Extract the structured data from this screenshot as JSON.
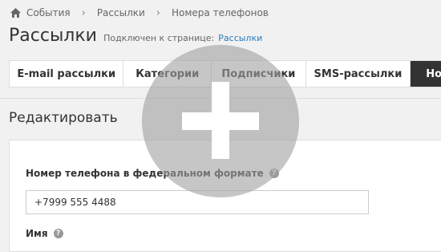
{
  "breadcrumb": {
    "items": [
      {
        "label": "События"
      },
      {
        "label": "Рассылки"
      },
      {
        "label": "Номера телефонов"
      }
    ],
    "separator": "›"
  },
  "header": {
    "title": "Рассылки",
    "connected_label": "Подключен к странице:",
    "connected_link": "Рассылки"
  },
  "tabs": [
    {
      "label": "E-mail рассылки"
    },
    {
      "label": "Категории"
    },
    {
      "label": "Подписчики"
    },
    {
      "label": "SMS-рассылки"
    },
    {
      "label": "Но",
      "active": true
    }
  ],
  "section": {
    "title": "Редактировать"
  },
  "form": {
    "phone_label": "Номер телефона в федеральном формате",
    "phone_value": "+7999 555 4488",
    "name_label": "Имя",
    "help_glyph": "?"
  },
  "overlay": {
    "icon": "plus-icon"
  },
  "colors": {
    "background": "#f1f1f1",
    "panel": "#ffffff",
    "link": "#2b7bb9",
    "active_tab": "#333333",
    "help_icon": "#999999"
  }
}
